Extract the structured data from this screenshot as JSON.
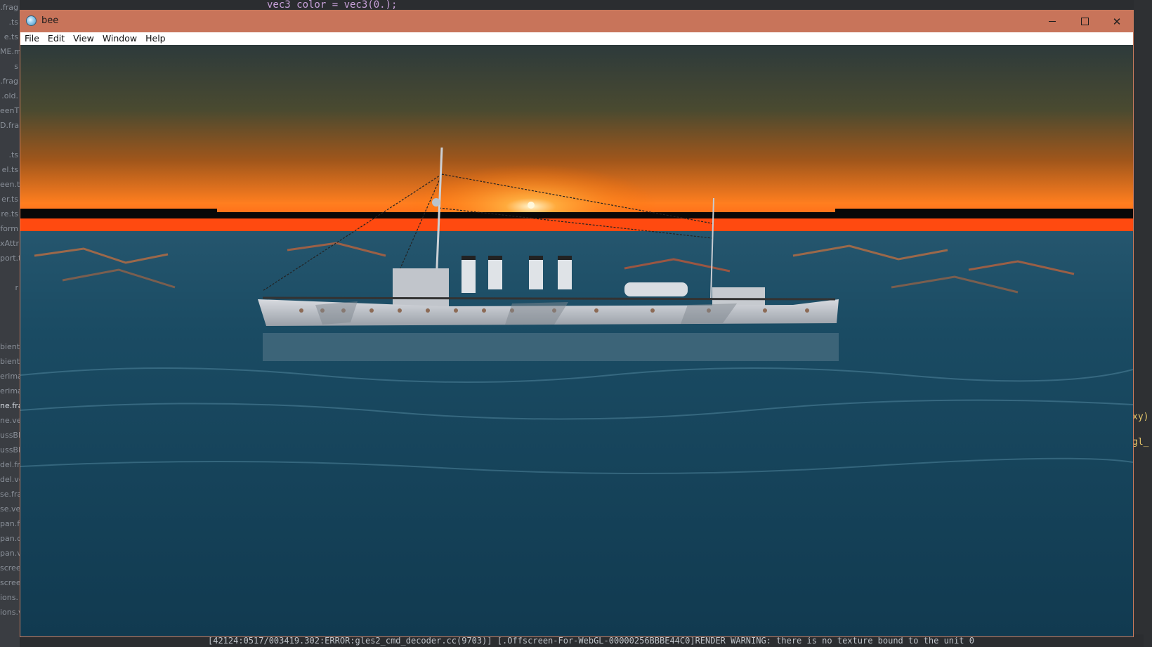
{
  "background_editor": {
    "file_list": [
      ".frag",
      ".ts",
      "e.ts",
      "ME.m",
      "s",
      ".frag",
      ".old.",
      "eenT",
      "D.fra",
      "",
      ".ts",
      "el.ts",
      "een.t",
      "er.ts",
      "re.ts",
      "form",
      "xAttr",
      "port.t",
      "",
      "r",
      "",
      "",
      "",
      "bient",
      "bient",
      "erima",
      "erima",
      "ne.fra",
      "ne.ve",
      "ussBlu",
      "ussBlu",
      "del.fr",
      "del.ve",
      "se.fra",
      "se.ve",
      "pan.fr",
      "pan.ol",
      "pan.ve",
      "scree",
      "scree",
      "ions.",
      "ions.vert"
    ],
    "active_file": "ne.fra",
    "code_line": "vec3 color = vec3(0.);",
    "right_fragments": [
      "xy)",
      "gl_"
    ],
    "console_line": "[42124:0517/003419.302:ERROR:gles2_cmd_decoder.cc(9703)] [.Offscreen-For-WebGL-00000256BBBE44C0]RENDER WARNING: there is no texture bound to the unit 0"
  },
  "window": {
    "title": "bee",
    "icon": "bee-app-icon",
    "controls": {
      "minimize": "minimize-icon",
      "maximize": "maximize-icon",
      "close": "close-icon",
      "close_glyph": "✕"
    }
  },
  "menu": {
    "items": [
      "File",
      "Edit",
      "View",
      "Window",
      "Help"
    ]
  },
  "scene": {
    "description_colors": {
      "sky_top": "#2f3a3c",
      "sky_horizon": "#ff7a1c",
      "sun": "#ffe9b0",
      "sea": "#123e54",
      "ship_hull": "#c9ccd1"
    }
  }
}
